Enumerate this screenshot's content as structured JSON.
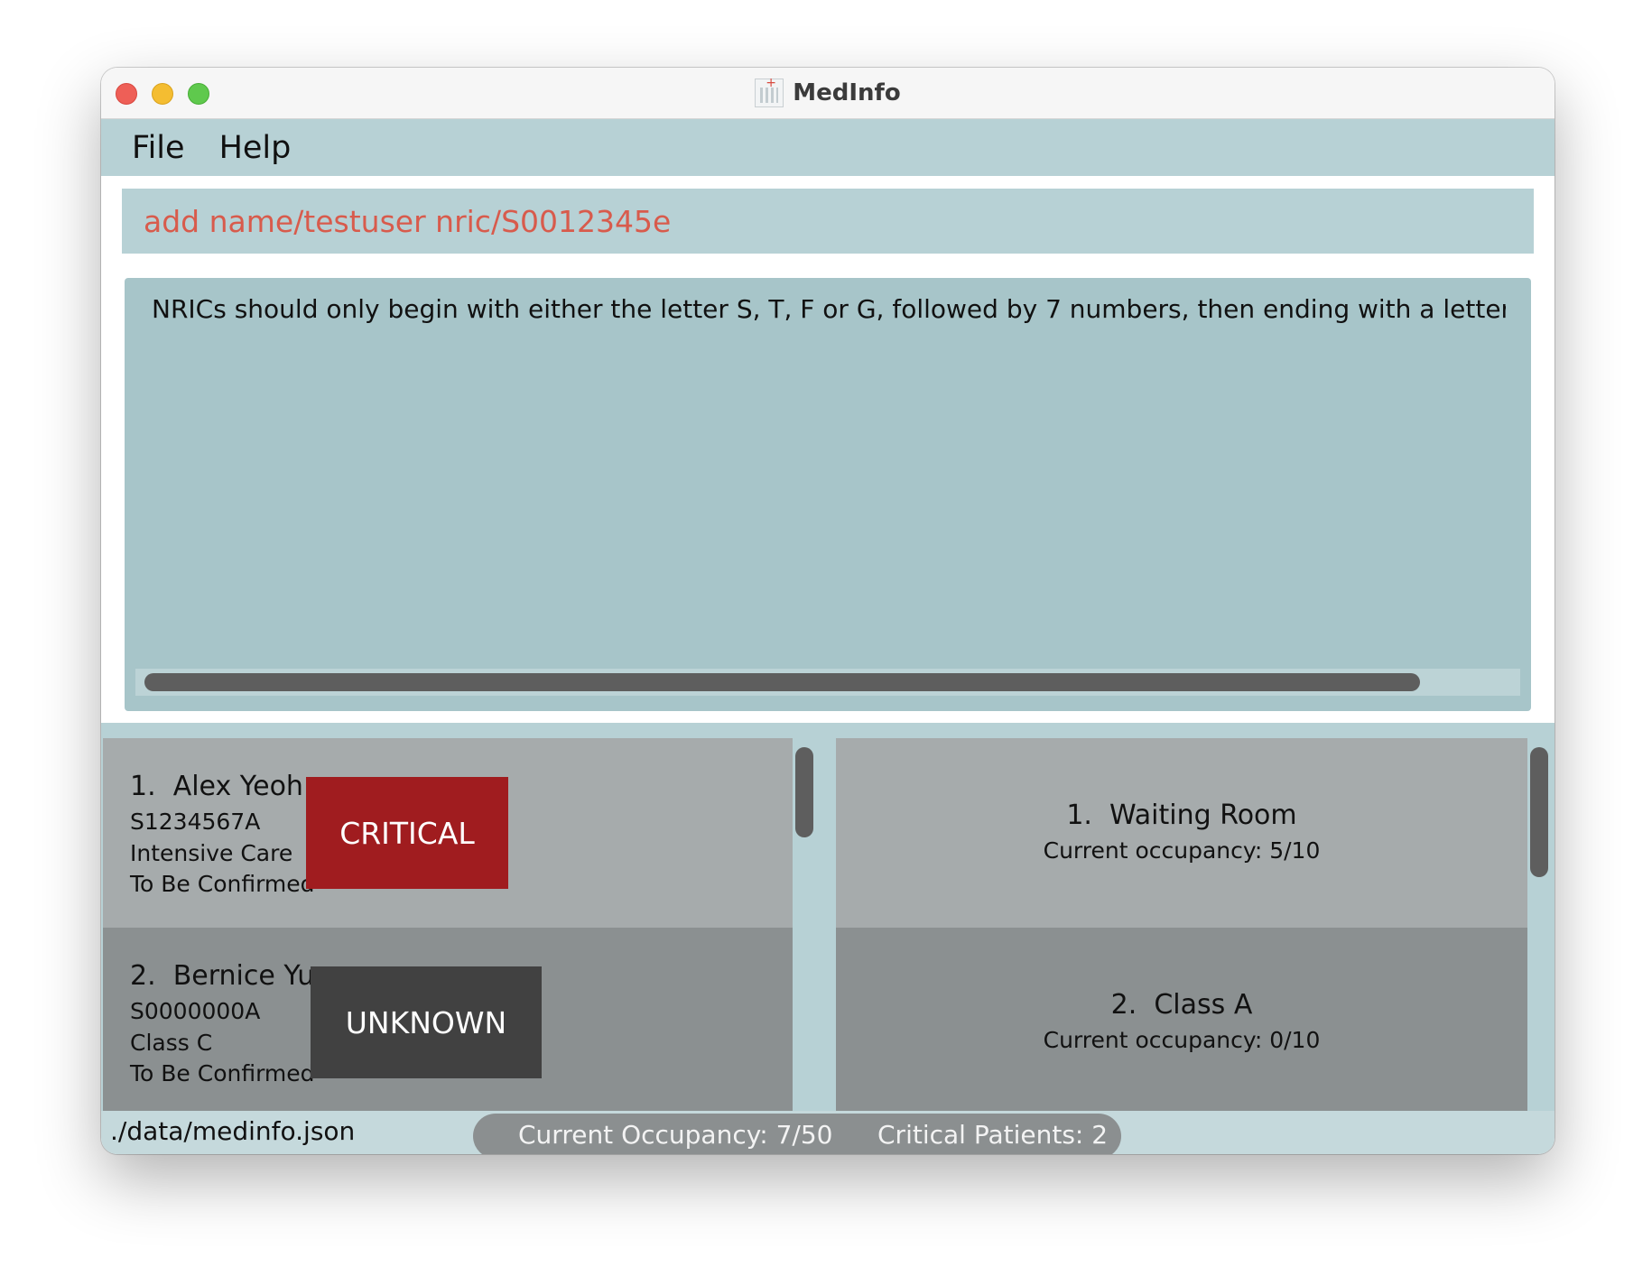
{
  "window": {
    "title": "MedInfo",
    "icon": "hospital-icon"
  },
  "menu": {
    "items": [
      "File",
      "Help"
    ]
  },
  "command": {
    "value": "add name/testuser nric/S0012345e",
    "color": "#d85b4c"
  },
  "result": {
    "text": "NRICs should only begin with either the letter S, T, F or G, followed by 7 numbers, then ending with a letter, and it should not b"
  },
  "patients": [
    {
      "index": "1.",
      "name": "Alex Yeoh",
      "nric": "S1234567A",
      "ward": "Intensive Care",
      "discharge": "To Be Confirmed",
      "status": "CRITICAL",
      "status_color": "#a01c1f"
    },
    {
      "index": "2.",
      "name": "Bernice Yu",
      "nric": "S0000000A",
      "ward": "Class C",
      "discharge": "To Be Confirmed",
      "status": "UNKNOWN",
      "status_color": "#414141"
    }
  ],
  "wards": [
    {
      "index": "1.",
      "name": "Waiting Room",
      "occupancy": "Current occupancy: 5/10"
    },
    {
      "index": "2.",
      "name": "Class A",
      "occupancy": "Current occupancy: 0/10"
    }
  ],
  "status_bar": {
    "path": "./data/medinfo.json",
    "occupancy": "Current Occupancy: 7/50",
    "critical": "Critical Patients: 2"
  }
}
